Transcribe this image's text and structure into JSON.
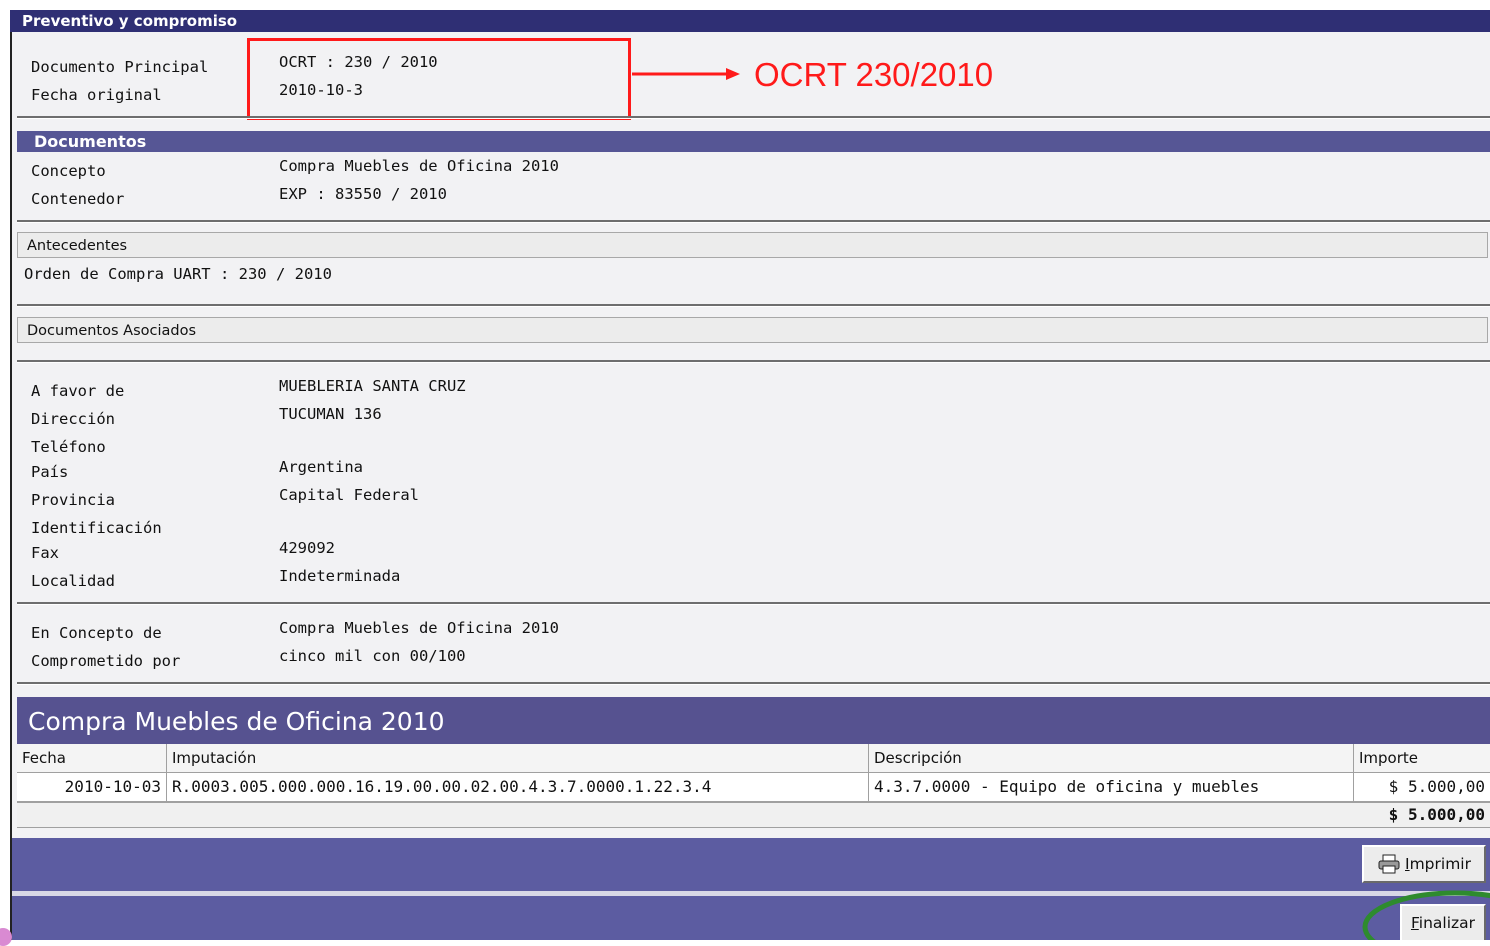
{
  "window": {
    "title": "Preventivo y compromiso"
  },
  "principal": {
    "doc_label": "Documento Principal",
    "doc_value": "OCRT : 230 / 2010",
    "fecha_label": "Fecha original",
    "fecha_value": "2010-10-3"
  },
  "annotation": {
    "text": "OCRT 230/2010",
    "color": "#ff1a1a"
  },
  "documentos": {
    "header": "Documentos",
    "concepto_label": "Concepto",
    "concepto_value": "Compra Muebles de Oficina 2010",
    "contenedor_label": "Contenedor",
    "contenedor_value": "EXP : 83550 / 2010"
  },
  "antecedentes": {
    "header": "Antecedentes",
    "item": "Orden de Compra UART : 230 / 2010"
  },
  "asociados": {
    "header": "Documentos Asociados"
  },
  "beneficiario": {
    "favor_label": "A favor de",
    "favor_value": "MUEBLERIA SANTA CRUZ",
    "direccion_label": "Dirección",
    "direccion_value": "TUCUMAN 136",
    "telefono_label": "Teléfono",
    "pais_label": "País",
    "pais_value": "Argentina",
    "provincia_label": "Provincia",
    "provincia_value": "Capital Federal",
    "identificacion_label": "Identificación",
    "fax_label": "Fax",
    "fax_value": "429092",
    "localidad_label": "Localidad",
    "localidad_value": "Indeterminada"
  },
  "compromiso": {
    "concepto_label": "En Concepto de",
    "concepto_value": "Compra Muebles de Oficina 2010",
    "por_label": "Comprometido por",
    "por_value": "cinco mil con 00/100"
  },
  "table": {
    "title": "Compra Muebles de Oficina 2010",
    "columns": [
      "Fecha",
      "Imputación",
      "Descripción",
      "Importe"
    ],
    "rows": [
      [
        "2010-10-03",
        "R.0003.005.000.000.16.19.00.00.02.00.4.3.7.0000.1.22.3.4",
        "4.3.7.0000 - Equipo de oficina y muebles",
        "$ 5.000,00"
      ]
    ],
    "total": "$ 5.000,00"
  },
  "buttons": {
    "imprimir_key": "I",
    "imprimir_rest": "mprimir",
    "finalizar_key": "F",
    "finalizar_rest": "inalizar"
  }
}
